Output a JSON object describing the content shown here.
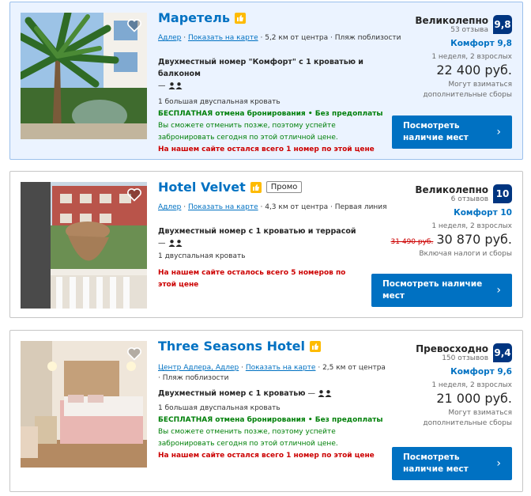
{
  "hotels": [
    {
      "name": "Маретель",
      "promo": "",
      "location": {
        "area": "Адлер",
        "map_link": "Показать на карте",
        "distance": "5,2 км от центра",
        "extra": "Пляж поблизости"
      },
      "room_name": "Двухместный номер \"Комфорт\" с 1 кроватью и балконом",
      "room_dash": "—",
      "bed": "1 большая двуспальная кровать",
      "free_cancel": "БЕСПЛАТНАЯ отмена бронирования • Без предоплаты",
      "cancel_desc": "Вы сможете отменить позже, поэтому успейте забронировать сегодня по этой отличной цене.",
      "warning": "На нашем сайте остался всего 1 номер по этой цене",
      "rating_word": "Великолепно",
      "reviews": "53 отзыва",
      "score": "9,8",
      "comfort": "Комфорт 9,8",
      "nights": "1 неделя, 2 взрослых",
      "old_price": "",
      "price": "22 400 руб.",
      "extra_fees": "Могут взиматься дополнительные сборы",
      "button": "Посмотреть наличие мест"
    },
    {
      "name": "Hotel Velvet",
      "promo": "Промо",
      "location": {
        "area": "Адлер",
        "map_link": "Показать на карте",
        "distance": "4,3 км от центра",
        "extra": "Первая линия"
      },
      "room_name": "Двухместный номер с 1 кроватью и террасой",
      "room_dash": "—",
      "bed": "1 двуспальная кровать",
      "free_cancel": "",
      "cancel_desc": "",
      "warning": "На нашем сайте осталось всего 5 номеров по этой цене",
      "rating_word": "Великолепно",
      "reviews": "6 отзывов",
      "score": "10",
      "comfort": "Комфорт 10",
      "nights": "1 неделя, 2 взрослых",
      "old_price": "31 490 руб.",
      "price": "30 870 руб.",
      "extra_fees": "Включая налоги и сборы",
      "button": "Посмотреть наличие мест"
    },
    {
      "name": "Three Seasons Hotel",
      "promo": "",
      "location": {
        "area": "Центр Адлера, Адлер",
        "map_link": "Показать на карте",
        "distance": "2,5 км от центра",
        "extra": "Пляж поблизости"
      },
      "room_name": "Двухместный номер с 1 кроватью",
      "room_dash": "—",
      "bed": "1 большая двуспальная кровать",
      "free_cancel": "БЕСПЛАТНАЯ отмена бронирования • Без предоплаты",
      "cancel_desc": "Вы сможете отменить позже, поэтому успейте забронировать сегодня по этой отличной цене.",
      "warning": "На нашем сайте остался всего 1 номер по этой цене",
      "rating_word": "Превосходно",
      "reviews": "150 отзывов",
      "score": "9,4",
      "comfort": "Комфорт 9,6",
      "nights": "1 неделя, 2 взрослых",
      "old_price": "",
      "price": "21 000 руб.",
      "extra_fees": "Могут взиматься дополнительные сборы",
      "button": "Посмотреть наличие мест"
    }
  ],
  "icons": {
    "favorite": "heart-icon",
    "preferred": "thumbs-up-icon",
    "occupancy": "two-people-icon",
    "button_arrow": "chevron-right-icon"
  },
  "colors": {
    "link": "#0071c2",
    "score_bg": "#003580",
    "green": "#008009",
    "warning": "#cc0000",
    "highlight_bg": "#ebf3ff",
    "preferred_badge": "#febb02"
  }
}
